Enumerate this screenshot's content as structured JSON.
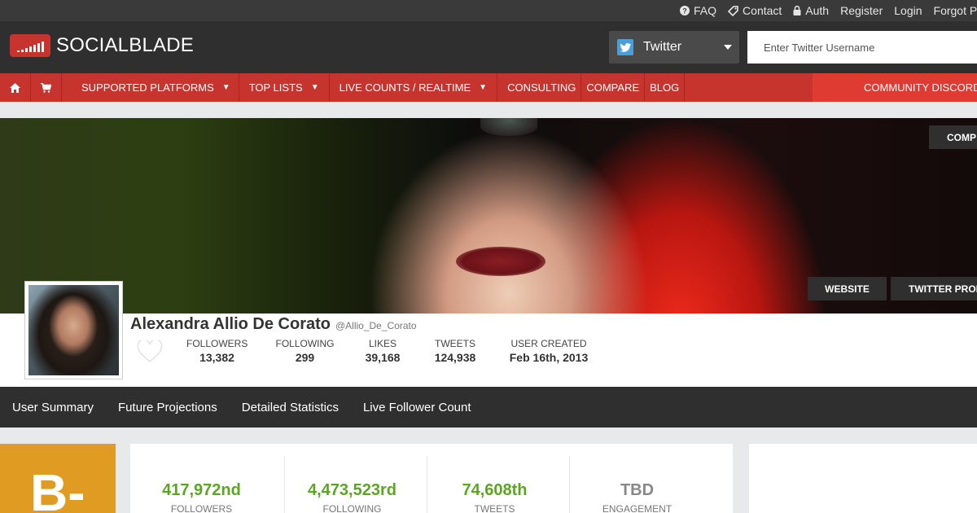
{
  "top_links": [
    {
      "label": "FAQ",
      "icon": "question-circle-icon"
    },
    {
      "label": "Contact",
      "icon": "tag-icon"
    },
    {
      "label": "Auth",
      "icon": "lock-icon"
    },
    {
      "label": "Register"
    },
    {
      "label": "Login"
    },
    {
      "label": "Forgot Pa"
    }
  ],
  "header": {
    "logo_text": "SOCIALBLADE",
    "platform": "Twitter",
    "search_placeholder": "Enter Twitter Username"
  },
  "nav": {
    "items": [
      {
        "label": "SUPPORTED PLATFORMS",
        "dropdown": "▼"
      },
      {
        "label": "TOP LISTS",
        "dropdown": "▼"
      },
      {
        "label": "LIVE COUNTS / REALTIME",
        "dropdown": "▼"
      },
      {
        "label": "CONSULTING"
      },
      {
        "label": "COMPARE"
      },
      {
        "label": "BLOG"
      }
    ],
    "discord_label": "COMMUNITY DISCORD"
  },
  "banner": {
    "compare_label": "COMP",
    "website_label": "WEBSITE",
    "twitter_profile_label": "TWITTER PROI"
  },
  "profile": {
    "name": "Alexandra Allio De Corato",
    "handle": "@Allio_De_Corato",
    "stats": [
      {
        "label": "FOLLOWERS",
        "value": "13,382"
      },
      {
        "label": "FOLLOWING",
        "value": "299"
      },
      {
        "label": "LIKES",
        "value": "39,168"
      },
      {
        "label": "TWEETS",
        "value": "124,938"
      },
      {
        "label": "USER CREATED",
        "value": "Feb 16th, 2013"
      }
    ]
  },
  "tabs": [
    "User Summary",
    "Future Projections",
    "Detailed Statistics",
    "Live Follower Count"
  ],
  "grade": "B-",
  "ranks": [
    {
      "value": "417,972nd",
      "label": "FOLLOWERS"
    },
    {
      "value": "4,473,523rd",
      "label": "FOLLOWING"
    },
    {
      "value": "74,608th",
      "label": "TWEETS"
    },
    {
      "value": "TBD",
      "label": "ENGAGEMENT"
    }
  ],
  "colors": {
    "brand_red": "#c6342d",
    "discord_red": "#e03b33",
    "grade_orange": "#e09b22",
    "rank_green": "#5aa71f",
    "dark": "#2f2f2f"
  }
}
